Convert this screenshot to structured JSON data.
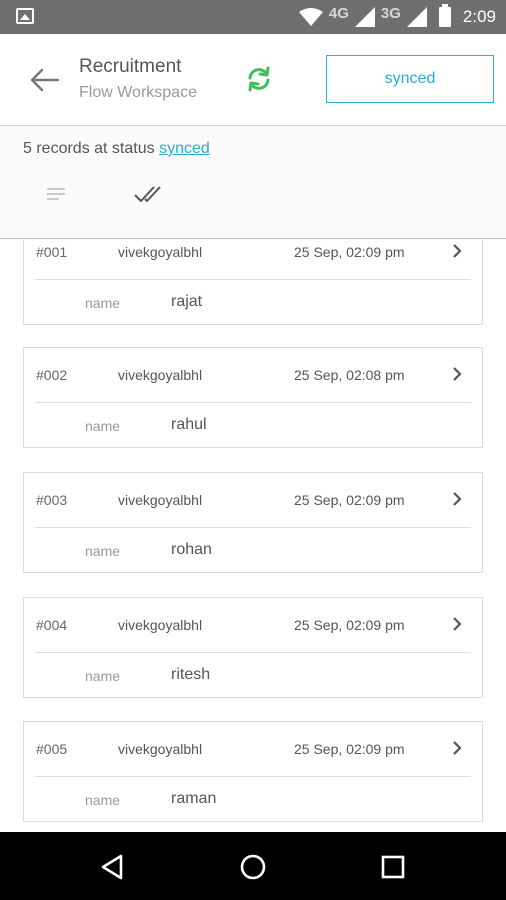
{
  "status_bar": {
    "network_4g": "4G",
    "network_3g": "3G",
    "time": "2:09"
  },
  "header": {
    "title": "Recruitment",
    "subtitle": "Flow Workspace",
    "status_chip": "synced",
    "accent_color": "#26afd6",
    "sync_icon_color": "#3fbf5a"
  },
  "summary": {
    "prefix": "5 records at status",
    "status_link": "synced"
  },
  "records": [
    {
      "id": "#001",
      "user": "vivekgoyalbhl",
      "time": "25 Sep, 02:09 pm",
      "field_label": "name",
      "field_value": "rajat"
    },
    {
      "id": "#002",
      "user": "vivekgoyalbhl",
      "time": "25 Sep, 02:08 pm",
      "field_label": "name",
      "field_value": "rahul"
    },
    {
      "id": "#003",
      "user": "vivekgoyalbhl",
      "time": "25 Sep, 02:09 pm",
      "field_label": "name",
      "field_value": "rohan"
    },
    {
      "id": "#004",
      "user": "vivekgoyalbhl",
      "time": "25 Sep, 02:09 pm",
      "field_label": "name",
      "field_value": "ritesh"
    },
    {
      "id": "#005",
      "user": "vivekgoyalbhl",
      "time": "25 Sep, 02:09 pm",
      "field_label": "name",
      "field_value": "raman"
    }
  ],
  "icons": {
    "back": "arrow-back-icon",
    "sync": "sync-icon",
    "filter": "filter-lines-icon",
    "done_all": "double-check-icon",
    "chevron": "chevron-right-icon",
    "nav_back": "triangle-back-icon",
    "nav_home": "circle-home-icon",
    "nav_recent": "square-recent-icon"
  }
}
